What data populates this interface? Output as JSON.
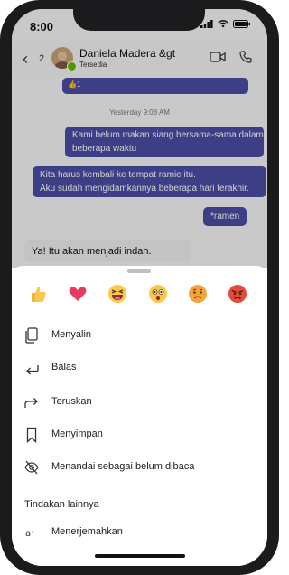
{
  "status": {
    "time": "8:00"
  },
  "header": {
    "back_count": "2",
    "contact_name": "Daniela Madera &gt",
    "contact_status": "Tersedia"
  },
  "chat": {
    "reaction_count": "1",
    "timestamp": "Yesterday 9:08 AM",
    "messages_out": [
      {
        "line1": "Kami belum makan siang bersama-sama dalam",
        "line2": "beberapa waktu"
      },
      {
        "line1": "Kita harus kembali ke tempat ramie itu.",
        "line2": "Aku sudah mengidamkannya beberapa hari terakhir."
      },
      {
        "line1": "*ramen"
      }
    ],
    "message_in": "Ya! Itu akan menjadi indah."
  },
  "reactions": [
    "like-emoji",
    "heart-emoji",
    "laugh-emoji",
    "surprised-emoji",
    "sad-emoji",
    "angry-emoji"
  ],
  "actions": {
    "copy": "Menyalin",
    "reply": "Balas",
    "forward": "Teruskan",
    "save": "Menyimpan",
    "mark_unread": "Menandai sebagai belum dibaca",
    "more_label": "Tindakan lainnya",
    "translate": "Menerjemahkan"
  },
  "colors": {
    "accent": "#4b4da4",
    "presence": "#6bb700"
  }
}
